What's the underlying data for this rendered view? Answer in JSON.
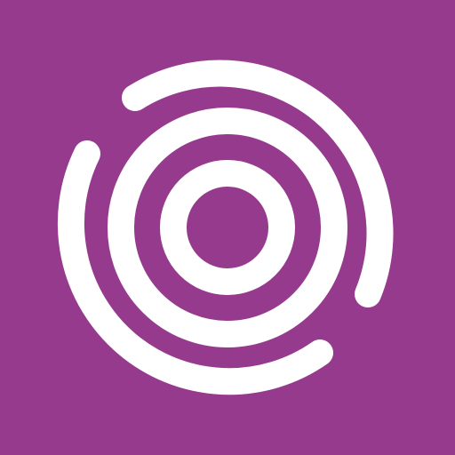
{
  "icon": {
    "name": "concentric-rings-logo-icon",
    "background_color": "#963a8e",
    "foreground_color": "#ffffff"
  }
}
